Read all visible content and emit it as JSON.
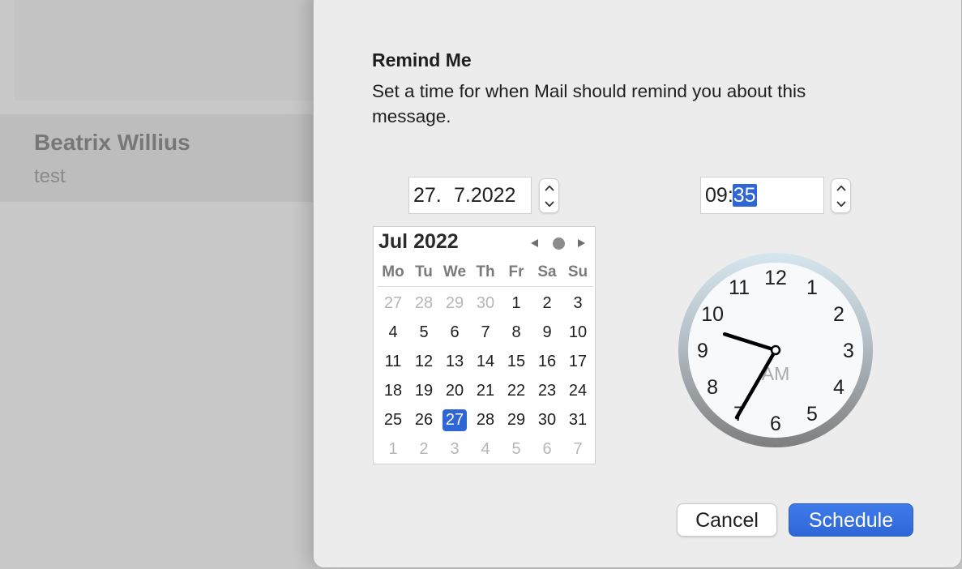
{
  "background": {
    "sender": "Beatrix Willius",
    "subject": "test"
  },
  "dialog": {
    "title": "Remind Me",
    "message": "Set a time for when Mail should remind you about this message.",
    "date": {
      "day": "27.",
      "month_year": "7.2022"
    },
    "time": {
      "hour": "09",
      "separator": ":",
      "minute": "35"
    },
    "calendar": {
      "month_label": "Jul 2022",
      "weekdays": [
        "Mo",
        "Tu",
        "We",
        "Th",
        "Fr",
        "Sa",
        "Su"
      ],
      "weeks": [
        [
          {
            "d": "27",
            "m": true
          },
          {
            "d": "28",
            "m": true
          },
          {
            "d": "29",
            "m": true
          },
          {
            "d": "30",
            "m": true
          },
          {
            "d": "1"
          },
          {
            "d": "2"
          },
          {
            "d": "3"
          }
        ],
        [
          {
            "d": "4"
          },
          {
            "d": "5"
          },
          {
            "d": "6"
          },
          {
            "d": "7"
          },
          {
            "d": "8"
          },
          {
            "d": "9"
          },
          {
            "d": "10"
          }
        ],
        [
          {
            "d": "11"
          },
          {
            "d": "12"
          },
          {
            "d": "13"
          },
          {
            "d": "14"
          },
          {
            "d": "15"
          },
          {
            "d": "16"
          },
          {
            "d": "17"
          }
        ],
        [
          {
            "d": "18"
          },
          {
            "d": "19"
          },
          {
            "d": "20"
          },
          {
            "d": "21"
          },
          {
            "d": "22"
          },
          {
            "d": "23"
          },
          {
            "d": "24"
          }
        ],
        [
          {
            "d": "25"
          },
          {
            "d": "26"
          },
          {
            "d": "27",
            "sel": true
          },
          {
            "d": "28"
          },
          {
            "d": "29"
          },
          {
            "d": "30"
          },
          {
            "d": "31"
          }
        ],
        [
          {
            "d": "1",
            "m": true
          },
          {
            "d": "2",
            "m": true
          },
          {
            "d": "3",
            "m": true
          },
          {
            "d": "4",
            "m": true
          },
          {
            "d": "5",
            "m": true
          },
          {
            "d": "6",
            "m": true
          },
          {
            "d": "7",
            "m": true
          }
        ]
      ]
    },
    "clock": {
      "numbers": [
        "12",
        "1",
        "2",
        "3",
        "4",
        "5",
        "6",
        "7",
        "8",
        "9",
        "10",
        "11"
      ],
      "period": "AM",
      "hour": 9,
      "minute": 35
    },
    "buttons": {
      "cancel": "Cancel",
      "schedule": "Schedule"
    },
    "colors": {
      "accent": "#2f66d6",
      "sheet": "#ececec"
    },
    "icons": {
      "prev": "triangle-left-icon",
      "today": "dot-icon",
      "next": "triangle-right-icon",
      "stepper_up": "chevron-up-icon",
      "stepper_down": "chevron-down-icon"
    }
  }
}
